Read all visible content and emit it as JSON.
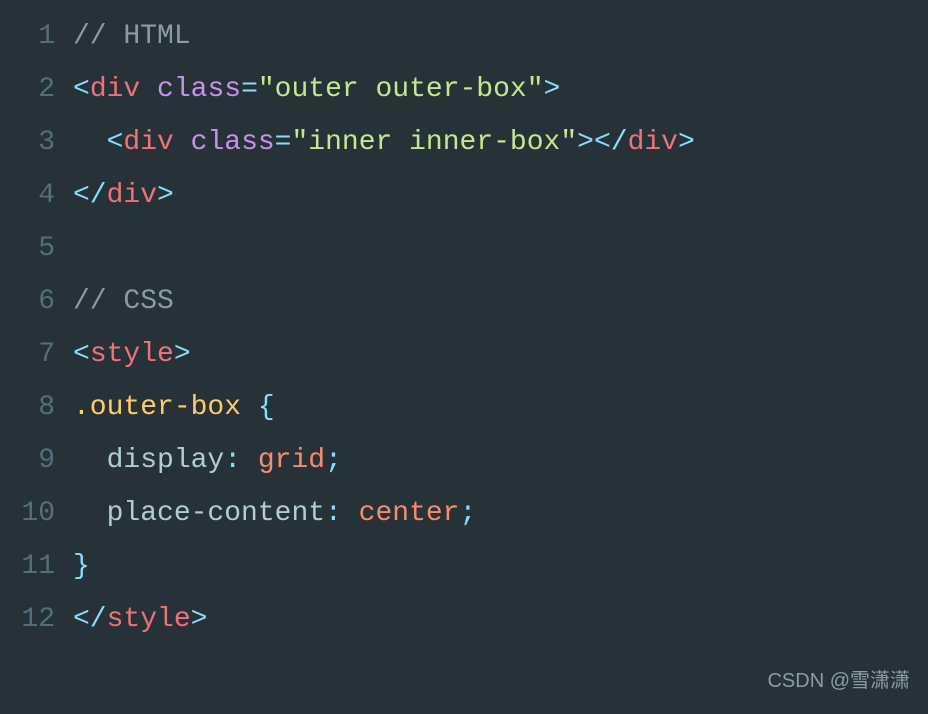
{
  "gutter": [
    "1",
    "2",
    "3",
    "4",
    "5",
    "6",
    "7",
    "8",
    "9",
    "10",
    "11",
    "12"
  ],
  "lines": {
    "l1": {
      "comment": "// HTML"
    },
    "l2": {
      "open1": "<",
      "tag1": "div",
      "sp1": " ",
      "attr1": "class",
      "eq1": "=",
      "val1": "\"outer outer-box\"",
      "close1": ">"
    },
    "l3": {
      "indent": "  ",
      "open1": "<",
      "tag1": "div",
      "sp1": " ",
      "attr1": "class",
      "eq1": "=",
      "val1": "\"inner inner-box\"",
      "close1": ">",
      "open2": "</",
      "tag2": "div",
      "close2": ">"
    },
    "l4": {
      "open1": "</",
      "tag1": "div",
      "close1": ">"
    },
    "l5": {
      "blank": ""
    },
    "l6": {
      "comment": "// CSS"
    },
    "l7": {
      "open1": "<",
      "tag1": "style",
      "close1": ">"
    },
    "l8": {
      "selector": ".outer-box",
      "sp": " ",
      "brace": "{"
    },
    "l9": {
      "indent": "  ",
      "prop": "display",
      "colon": ":",
      "sp": " ",
      "val": "grid",
      "semi": ";"
    },
    "l10": {
      "indent": "  ",
      "prop": "place-content",
      "colon": ":",
      "sp": " ",
      "val": "center",
      "semi": ";"
    },
    "l11": {
      "brace": "}"
    },
    "l12": {
      "open1": "</",
      "tag1": "style",
      "close1": ">"
    }
  },
  "watermark": "CSDN @雪潇潇"
}
